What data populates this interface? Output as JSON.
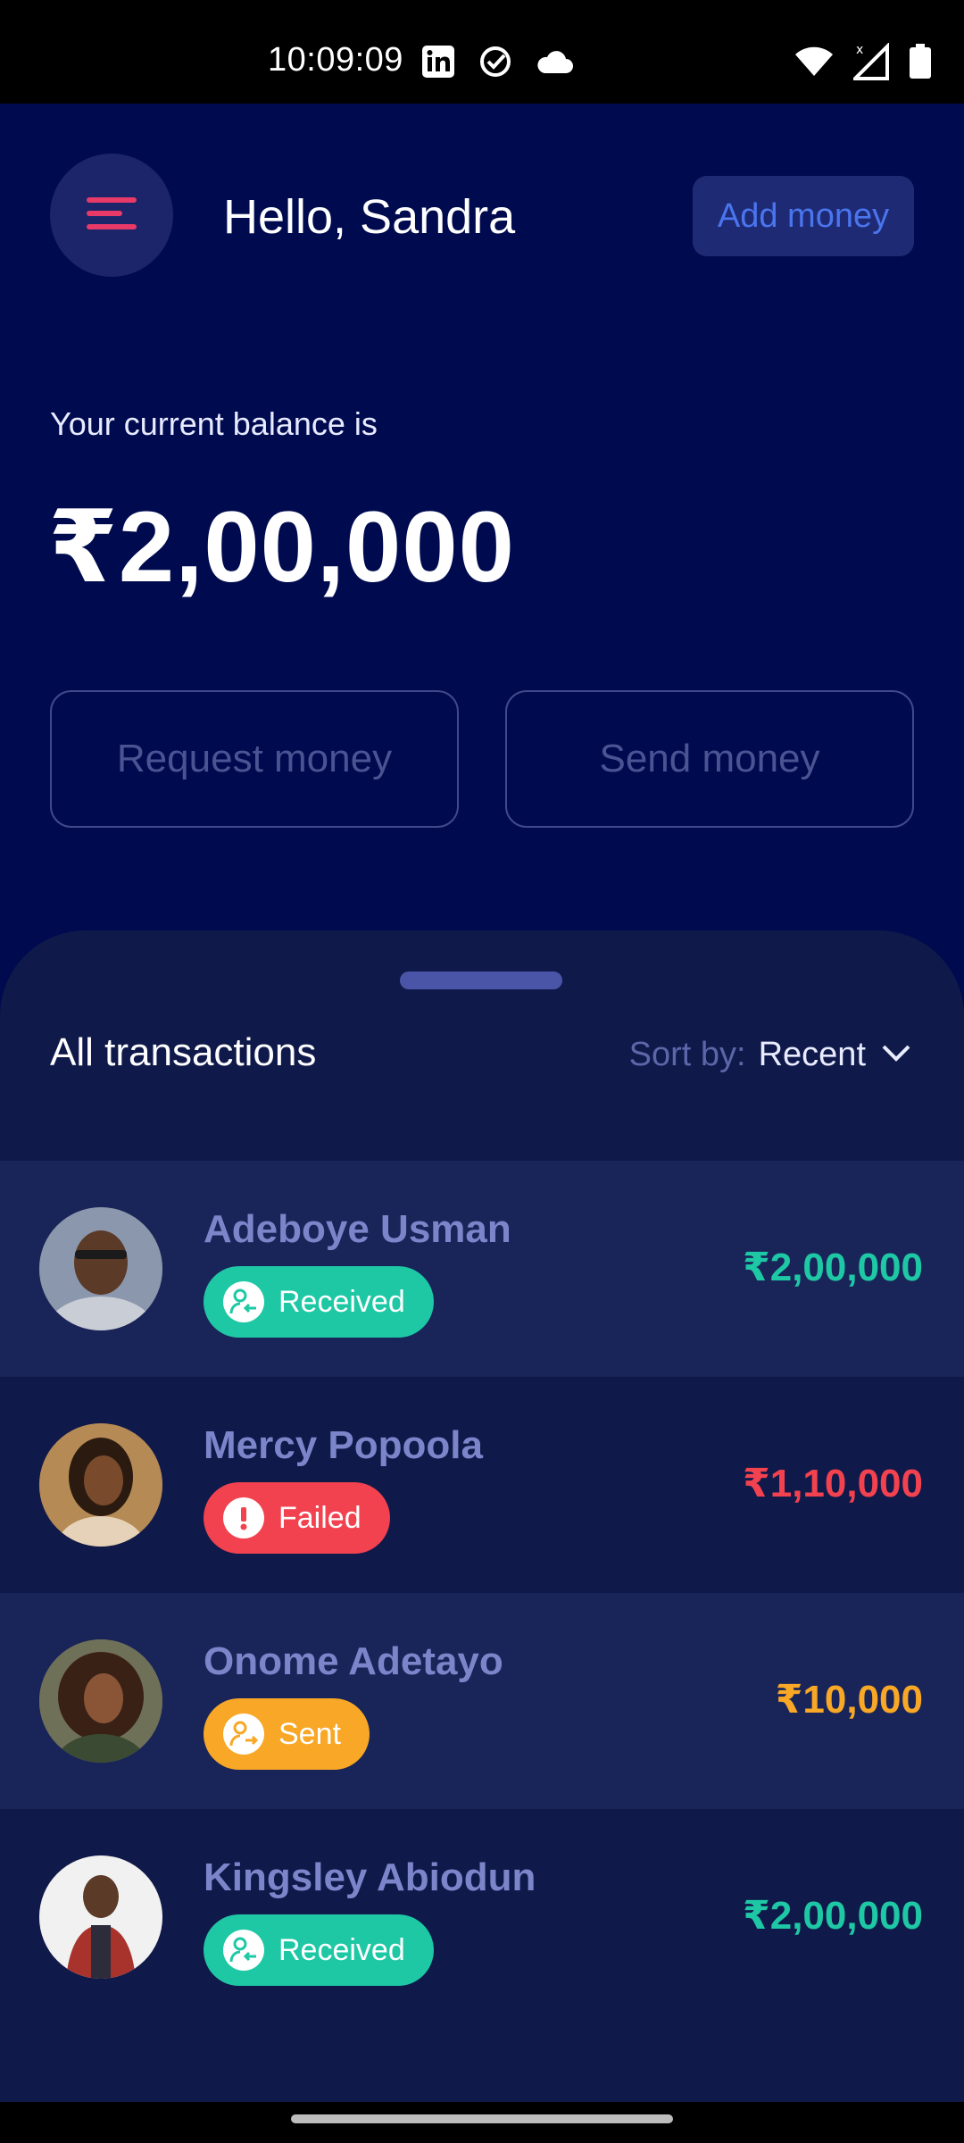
{
  "status_bar": {
    "time": "10:09:09",
    "left_icons": [
      "linkedin-icon",
      "check-circle-icon",
      "cloud-icon"
    ],
    "right_icons": [
      "wifi-icon",
      "signal-icon",
      "battery-icon"
    ]
  },
  "header": {
    "greeting": "Hello, Sandra",
    "add_money_label": "Add money",
    "menu_icon": "menu-icon",
    "accent_color": "#e83a68"
  },
  "balance": {
    "label": "Your current balance is",
    "value": "₹2,00,000"
  },
  "actions": {
    "request_label": "Request money",
    "send_label": "Send money"
  },
  "transactions": {
    "title": "All transactions",
    "sort_label": "Sort by:",
    "sort_value": "Recent",
    "items": [
      {
        "name": "Adeboye Usman",
        "status": "Received",
        "amount": "₹2,00,000",
        "status_color": "#1ec8a5",
        "amount_color": "#1ec8a5",
        "status_icon": "receive-user-icon"
      },
      {
        "name": "Mercy Popoola",
        "status": "Failed",
        "amount": "₹1,10,000",
        "status_color": "#f2424f",
        "amount_color": "#f2424f",
        "status_icon": "alert-icon"
      },
      {
        "name": "Onome Adetayo",
        "status": "Sent",
        "amount": "₹10,000",
        "status_color": "#f8a726",
        "amount_color": "#f8a726",
        "status_icon": "send-user-icon"
      },
      {
        "name": "Kingsley Abiodun",
        "status": "Received",
        "amount": "₹2,00,000",
        "status_color": "#1ec8a5",
        "amount_color": "#1ec8a5",
        "status_icon": "receive-user-icon"
      }
    ]
  }
}
